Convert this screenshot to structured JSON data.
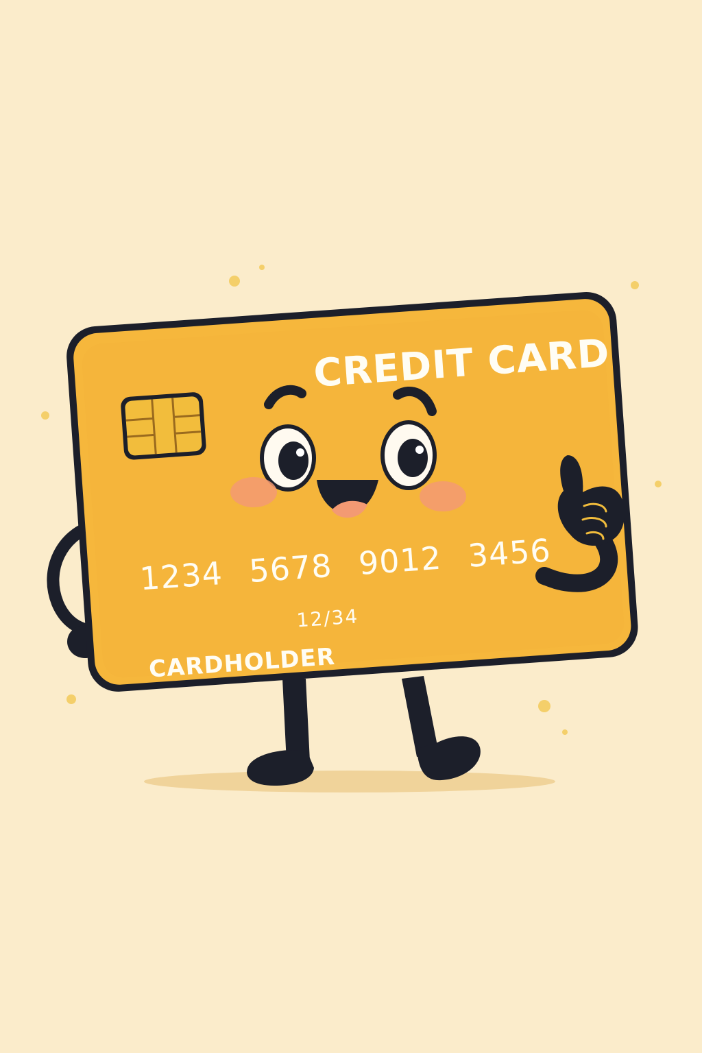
{
  "card": {
    "title": "CREDIT CARD",
    "number_groups": [
      "1234",
      "5678",
      "9012",
      "3456"
    ],
    "expiry": "12/34",
    "holder": "CARDHOLDER"
  },
  "colors": {
    "background": "#fbeccb",
    "card_body": "#f6b73c",
    "card_outline": "#1c1f2a",
    "chip": "#f2bd3c",
    "cheek": "#f39a73",
    "text": "#fffdf4",
    "shadow": "#f0d39a",
    "sparkle": "#f4cf6a"
  },
  "icons": [
    "emv-chip-icon",
    "thumbs-up-hand-icon",
    "resting-hand-icon",
    "sparkle-dot-icon"
  ]
}
